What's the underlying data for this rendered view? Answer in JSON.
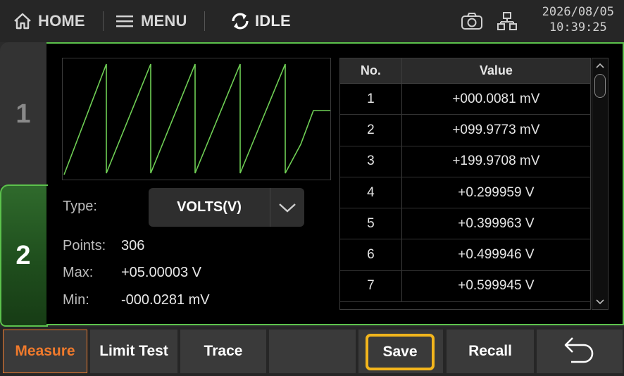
{
  "topbar": {
    "home_label": "HOME",
    "menu_label": "MENU",
    "status_label": "IDLE",
    "date": "2026/08/05",
    "time": "10:39:25"
  },
  "tabs": [
    {
      "label": "1",
      "active": false
    },
    {
      "label": "2",
      "active": true
    }
  ],
  "measurement": {
    "type_label": "Type:",
    "type_value": "VOLTS(V)",
    "points_label": "Points:",
    "points_value": "306",
    "max_label": "Max:",
    "max_value": "+05.00003 V",
    "min_label": "Min:",
    "min_value": "-000.0281 mV"
  },
  "table": {
    "headers": [
      "No.",
      "Value"
    ],
    "rows": [
      {
        "no": "1",
        "value": "+000.0081 mV"
      },
      {
        "no": "2",
        "value": "+099.9773 mV"
      },
      {
        "no": "3",
        "value": "+199.9708 mV"
      },
      {
        "no": "4",
        "value": "+0.299959 V"
      },
      {
        "no": "5",
        "value": "+0.399963 V"
      },
      {
        "no": "6",
        "value": "+0.499946 V"
      },
      {
        "no": "7",
        "value": "+0.599945 V"
      }
    ]
  },
  "softkeys": {
    "measure": "Measure",
    "limit_test": "Limit Test",
    "trace": "Trace",
    "save": "Save",
    "recall": "Recall"
  },
  "colors": {
    "accent_green": "#5cc24c",
    "trace_green": "#6fcf55",
    "measure_orange": "#f07a2c",
    "save_highlight": "#f2b51c"
  },
  "icons": {
    "home": "home-icon",
    "menu": "hamburger-menu-icon",
    "status": "refresh-icon",
    "camera": "camera-icon",
    "network": "network-icon",
    "back": "back-arrow-icon"
  }
}
